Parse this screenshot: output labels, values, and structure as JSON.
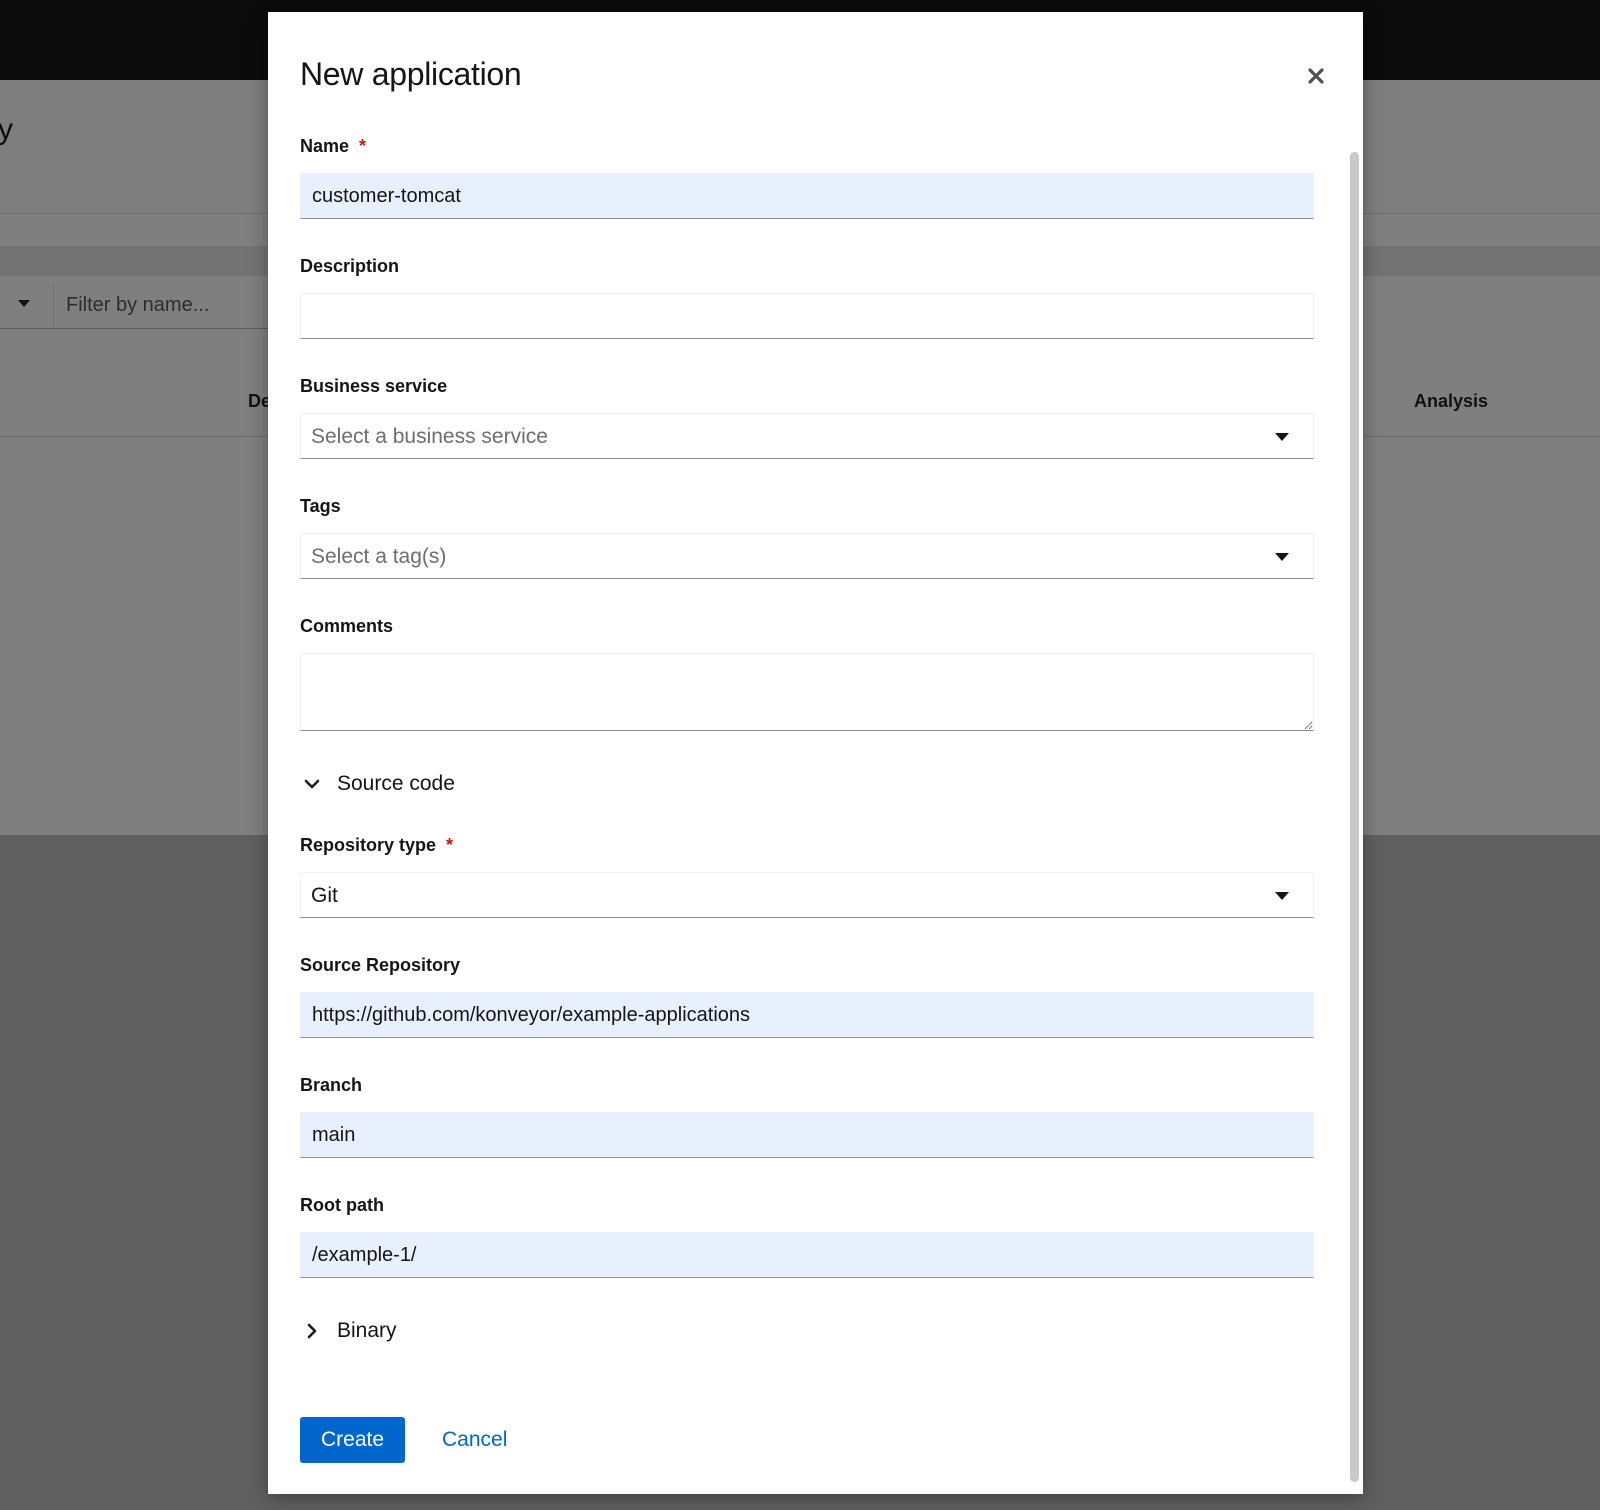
{
  "background": {
    "page_title_fragment": "y",
    "filter": {
      "placeholder": "Filter by name..."
    },
    "table_headers": {
      "partial_column": "De",
      "analysis": "Analysis"
    }
  },
  "modal": {
    "title": "New application",
    "close_icon": "close-icon",
    "fields": {
      "name": {
        "label": "Name",
        "required_marker": "*",
        "value": "customer-tomcat"
      },
      "description": {
        "label": "Description",
        "value": ""
      },
      "business_service": {
        "label": "Business service",
        "placeholder": "Select a business service"
      },
      "tags": {
        "label": "Tags",
        "placeholder": "Select a tag(s)"
      },
      "comments": {
        "label": "Comments",
        "value": ""
      },
      "repository_type": {
        "label": "Repository type",
        "required_marker": "*",
        "value": "Git"
      },
      "source_repository": {
        "label": "Source Repository",
        "value": "https://github.com/konveyor/example-applications"
      },
      "branch": {
        "label": "Branch",
        "value": "main"
      },
      "root_path": {
        "label": "Root path",
        "value": "/example-1/"
      }
    },
    "sections": {
      "source_code": {
        "label": "Source code",
        "expanded": true
      },
      "binary": {
        "label": "Binary",
        "expanded": false
      }
    },
    "actions": {
      "create": "Create",
      "cancel": "Cancel"
    }
  },
  "colors": {
    "primary": "#0066cc",
    "required": "#c9190b",
    "autofill": "#e8f0fe"
  }
}
